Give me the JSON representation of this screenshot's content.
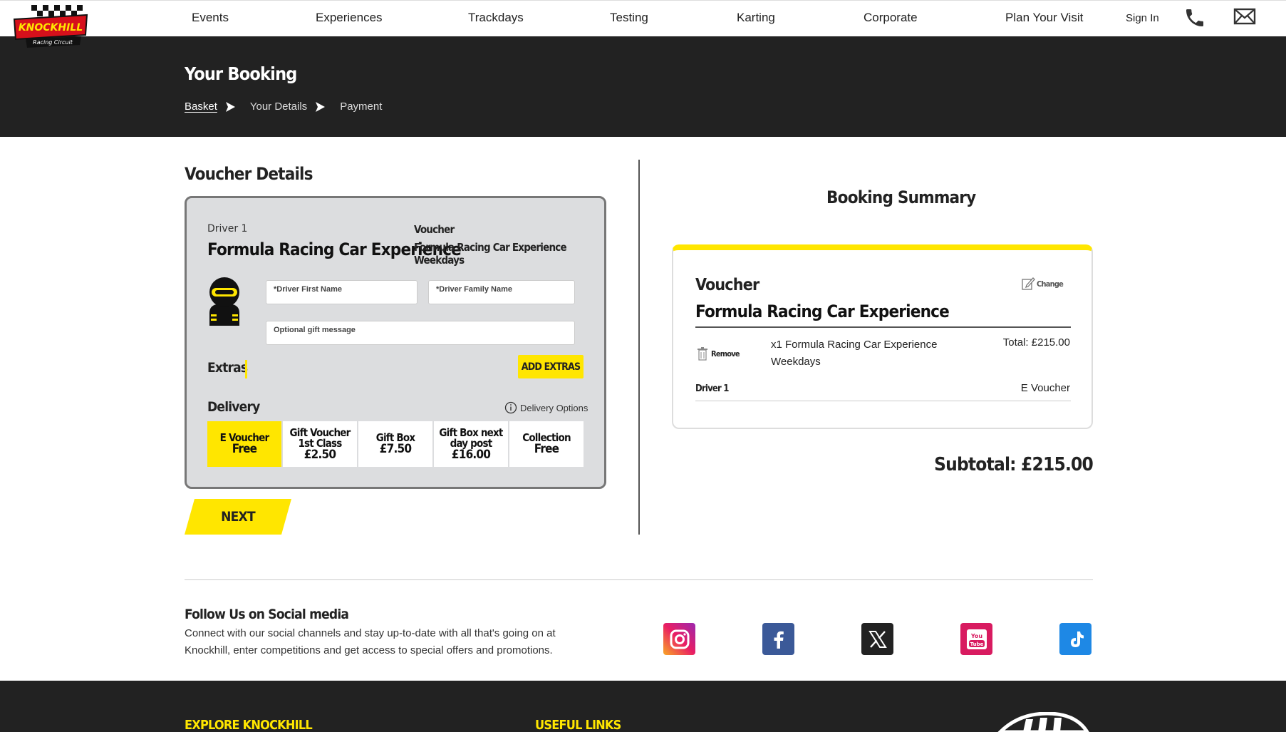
{
  "nav": {
    "items": [
      "Events",
      "Experiences",
      "Trackdays",
      "Testing",
      "Karting",
      "Corporate",
      "Plan Your Visit"
    ],
    "sign_in": "Sign In",
    "logo_text": "KNOCKHILL",
    "logo_sub": "Racing Circuit"
  },
  "header": {
    "title": "Your Booking",
    "crumbs": [
      "Basket",
      "Your Details",
      "Payment"
    ]
  },
  "voucher_details": {
    "title": "Voucher Details",
    "driver_label": "Driver 1",
    "experience": "Formula Racing Car Experience",
    "voucher_label": "Voucher",
    "voucher_name": "Formula Racing Car Experience Weekdays",
    "first_name_placeholder": "*Driver First Name",
    "family_name_placeholder": "*Driver Family Name",
    "gift_placeholder": "Optional gift message",
    "extras_label": "Extras",
    "add_extras": "ADD EXTRAS",
    "delivery_label": "Delivery",
    "delivery_options_link": "Delivery Options",
    "delivery_options": [
      {
        "l1": "E Voucher",
        "l2": "",
        "price": "Free",
        "selected": true
      },
      {
        "l1": "Gift Voucher",
        "l2": "1st Class",
        "price": "£2.50",
        "selected": false
      },
      {
        "l1": "Gift Box",
        "l2": "",
        "price": "£7.50",
        "selected": false
      },
      {
        "l1": "Gift Box next",
        "l2": "day post",
        "price": "£16.00",
        "selected": false
      },
      {
        "l1": "Collection",
        "l2": "",
        "price": "Free",
        "selected": false
      }
    ],
    "next_label": "NEXT"
  },
  "summary": {
    "title": "Booking Summary",
    "voucher_label": "Voucher",
    "change_label": "Change",
    "experience": "Formula Racing Car Experience",
    "remove_label": "Remove",
    "item_text": "x1 Formula Racing Car Experience Weekdays",
    "total": "Total: £215.00",
    "driver_label": "Driver 1",
    "driver_value": "E Voucher",
    "subtotal": "Subtotal: £215.00"
  },
  "social": {
    "title": "Follow Us on Social media",
    "description": "Connect with our social channels and stay up-to-date with all that's going on at Knockhill, enter competitions and get access to special offers and promotions.",
    "icons": [
      "instagram-icon",
      "facebook-icon",
      "x-icon",
      "youtube-icon",
      "tiktok-icon"
    ],
    "youtube_text": "You Tube"
  },
  "footer": {
    "col1": "EXPLORE KNOCKHILL",
    "col2": "USEFUL LINKS"
  },
  "colors": {
    "accent": "#ffe600",
    "dark": "#222222"
  }
}
